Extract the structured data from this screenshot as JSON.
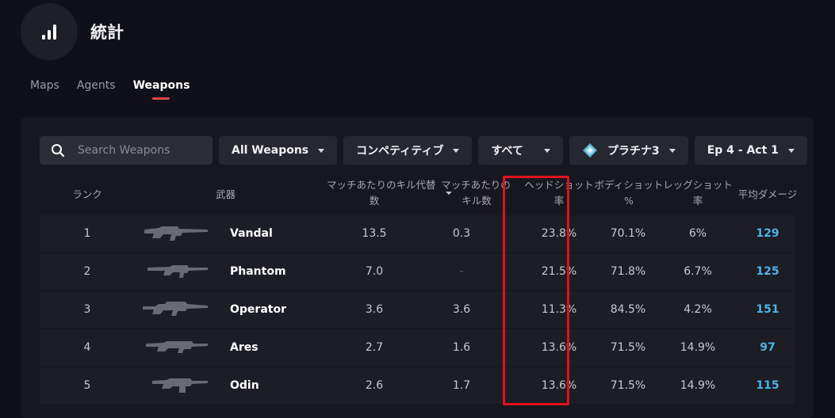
{
  "header": {
    "title": "統計",
    "icon": "bar-chart-icon"
  },
  "tabs": [
    {
      "label": "Maps",
      "active": false
    },
    {
      "label": "Agents",
      "active": false
    },
    {
      "label": "Weapons",
      "active": true
    }
  ],
  "filters": {
    "search_placeholder": "Search Weapons",
    "weapon_type": "All Weapons",
    "mode": "コンペティティブ",
    "scope": "すべて",
    "rank": "プラチナ3",
    "act": "Ep 4 - Act 1"
  },
  "table": {
    "columns": {
      "rank": "ランク",
      "weapon": "武器",
      "kills_a": "マッチあたりのキル代替",
      "kills_b": "数",
      "alt_a": "マッチあたりの",
      "alt_b": "キル数",
      "hs_a": "ヘッドショット",
      "hs_b": "率",
      "body_a": "ボディショット",
      "body_b": "%",
      "leg_a": "レッグショット",
      "leg_b": "率",
      "damage": "平均ダメージ"
    },
    "rows": [
      {
        "rank": "1",
        "weapon": "Vandal",
        "kills": "13.5",
        "alt": "0.3",
        "headshot": "23.8%",
        "bodyshot": "70.1%",
        "legshot": "6%",
        "damage": "129"
      },
      {
        "rank": "2",
        "weapon": "Phantom",
        "kills": "7.0",
        "alt": "-",
        "headshot": "21.5%",
        "bodyshot": "71.8%",
        "legshot": "6.7%",
        "damage": "125"
      },
      {
        "rank": "3",
        "weapon": "Operator",
        "kills": "3.6",
        "alt": "3.6",
        "headshot": "11.3%",
        "bodyshot": "84.5%",
        "legshot": "4.2%",
        "damage": "151"
      },
      {
        "rank": "4",
        "weapon": "Ares",
        "kills": "2.7",
        "alt": "1.6",
        "headshot": "13.6%",
        "bodyshot": "71.5%",
        "legshot": "14.9%",
        "damage": "97"
      },
      {
        "rank": "5",
        "weapon": "Odin",
        "kills": "2.6",
        "alt": "1.7",
        "headshot": "13.6%",
        "bodyshot": "71.5%",
        "legshot": "14.9%",
        "damage": "115"
      }
    ]
  },
  "colors": {
    "accent": "#e0434f",
    "damage": "#4fb2e4",
    "highlight": "#e0121b",
    "background": "#101118"
  }
}
